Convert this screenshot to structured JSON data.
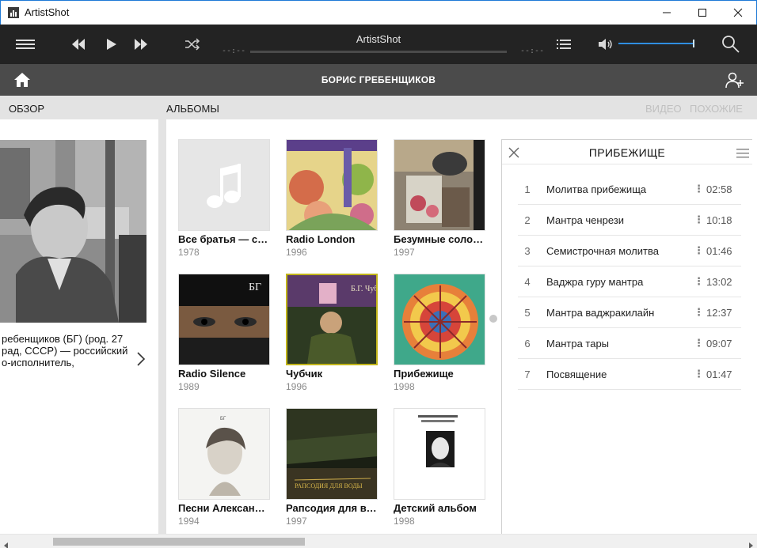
{
  "window": {
    "title": "ArtistShot"
  },
  "player": {
    "now_playing": "ArtistShot",
    "time_elapsed": "--:--",
    "time_total": "--:--",
    "volume_percent": 100
  },
  "artist": {
    "name": "БОРИС ГРЕБЕНЩИКОВ"
  },
  "sections": {
    "overview": "ОБЗОР",
    "albums": "АЛЬБОМЫ",
    "video": "ВИДЕО",
    "similar": "ПОХОЖИЕ"
  },
  "overview": {
    "bio_line1": "ребенщиков (БГ) (род. 27",
    "bio_line2": "рад, СССР) — российский",
    "bio_line3": "о-исполнитель,"
  },
  "albums": [
    {
      "name": "Все братья — сё…",
      "year": "1978"
    },
    {
      "name": "Radio London",
      "year": "1996"
    },
    {
      "name": "Безумные солов…",
      "year": "1997"
    },
    {
      "name": "Radio Silence",
      "year": "1989"
    },
    {
      "name": "Чубчик",
      "year": "1996"
    },
    {
      "name": "Прибежище",
      "year": "1998"
    },
    {
      "name": "Песни Александ…",
      "year": "1994"
    },
    {
      "name": "Рапсодия для во…",
      "year": "1997"
    },
    {
      "name": "Детский альбом",
      "year": "1998"
    }
  ],
  "covers": {
    "c4_text": "БГ",
    "c5_text": "Б.Г. Чубчик",
    "c7_text": "БГ",
    "c8_text": "РАПСОДИЯ ДЛЯ ВОДЫ"
  },
  "panel": {
    "title": "ПРИБЕЖИЩЕ",
    "tracks": [
      {
        "n": "1",
        "title": "Молитва прибежища",
        "dur": "02:58"
      },
      {
        "n": "2",
        "title": "Мантра ченрези",
        "dur": "10:18"
      },
      {
        "n": "3",
        "title": "Семистрочная молитва",
        "dur": "01:46"
      },
      {
        "n": "4",
        "title": "Ваджра гуру мантра",
        "dur": "13:02"
      },
      {
        "n": "5",
        "title": "Мантра ваджракилайн",
        "dur": "12:37"
      },
      {
        "n": "6",
        "title": "Мантра тары",
        "dur": "09:07"
      },
      {
        "n": "7",
        "title": "Посвящение",
        "dur": "01:47"
      }
    ]
  },
  "colors": {
    "accent": "#2f8ee0",
    "header_dark": "#232323",
    "artist_bar": "#4b4b4b"
  }
}
